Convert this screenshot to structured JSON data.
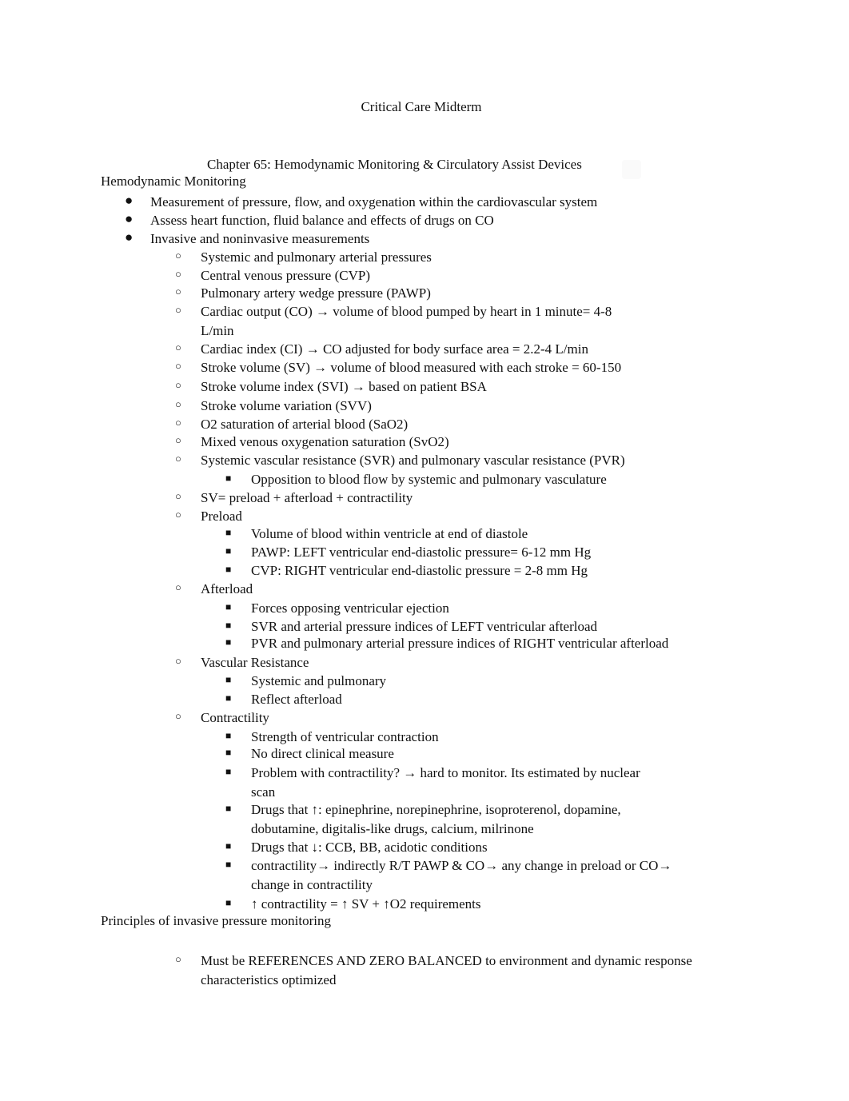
{
  "document": {
    "title": "Critical Care Midterm",
    "chapter": "Chapter 65: Hemodynamic Monitoring & Circulatory Assist Devices",
    "section1": "Hemodynamic Monitoring",
    "items": [
      {
        "level": 1,
        "bullet": "●",
        "text": "Measurement of pressure, flow, and oxygenation within the cardiovascular system"
      },
      {
        "level": 1,
        "bullet": "●",
        "text": "Assess heart function, fluid balance and effects of drugs on CO"
      },
      {
        "level": 1,
        "bullet": "●",
        "text": "Invasive and noninvasive measurements"
      },
      {
        "level": 2,
        "bullet": "○",
        "text": "Systemic and pulmonary arterial pressures"
      },
      {
        "level": 2,
        "bullet": "○",
        "text": "Central venous pressure (CVP)"
      },
      {
        "level": 2,
        "bullet": "○",
        "text": "Pulmonary artery wedge pressure (PAWP)"
      },
      {
        "level": 2,
        "bullet": "○",
        "text": "Cardiac output (CO) → volume of blood pumped by heart in 1 minute= 4-8",
        "cont": "L/min"
      },
      {
        "level": 2,
        "bullet": "○",
        "text": "Cardiac index (CI) → CO adjusted for body surface area = 2.2-4 L/min"
      },
      {
        "level": 2,
        "bullet": "○",
        "text": "Stroke volume (SV) → volume of blood measured with each stroke = 60-150"
      },
      {
        "level": 2,
        "bullet": "○",
        "text": "Stroke volume index (SVI) → based on patient BSA"
      },
      {
        "level": 2,
        "bullet": "○",
        "text": "Stroke volume variation (SVV)"
      },
      {
        "level": 2,
        "bullet": "○",
        "text": "O2 saturation of arterial blood (SaO2)"
      },
      {
        "level": 2,
        "bullet": "○",
        "text": "Mixed venous oxygenation saturation (SvO2)"
      },
      {
        "level": 2,
        "bullet": "○",
        "text": "Systemic vascular resistance (SVR) and pulmonary vascular resistance (PVR)"
      },
      {
        "level": 3,
        "bullet": "■",
        "text": "Opposition to blood flow by systemic and pulmonary vasculature"
      },
      {
        "level": 2,
        "bullet": "○",
        "text": "SV= preload + afterload + contractility"
      },
      {
        "level": 2,
        "bullet": "○",
        "text": "Preload"
      },
      {
        "level": 3,
        "bullet": "■",
        "text": "Volume of blood within ventricle at end of diastole"
      },
      {
        "level": 3,
        "bullet": "■",
        "text": "PAWP: LEFT ventricular end-diastolic pressure= 6-12 mm Hg"
      },
      {
        "level": 3,
        "bullet": "■",
        "text": "CVP: RIGHT ventricular end-diastolic pressure = 2-8 mm Hg"
      },
      {
        "level": 2,
        "bullet": "○",
        "text": "Afterload"
      },
      {
        "level": 3,
        "bullet": "■",
        "text": "Forces opposing ventricular ejection"
      },
      {
        "level": 3,
        "bullet": "■",
        "text": "SVR and arterial pressure indices of LEFT ventricular afterload"
      },
      {
        "level": 3,
        "bullet": "■",
        "text": "PVR and pulmonary arterial pressure indices of RIGHT ventricular afterload"
      },
      {
        "level": 2,
        "bullet": "○",
        "text": "Vascular Resistance"
      },
      {
        "level": 3,
        "bullet": "■",
        "text": "Systemic and pulmonary"
      },
      {
        "level": 3,
        "bullet": "■",
        "text": "Reflect afterload"
      },
      {
        "level": 2,
        "bullet": "○",
        "text": "Contractility"
      },
      {
        "level": 3,
        "bullet": "■",
        "text": "Strength of ventricular contraction"
      },
      {
        "level": 3,
        "bullet": "■",
        "text": "No direct clinical measure"
      },
      {
        "level": 3,
        "bullet": "■",
        "text": "Problem with contractility? → hard to monitor. Its estimated by nuclear",
        "cont": "scan"
      },
      {
        "level": 3,
        "bullet": "■",
        "text": "Drugs that ↑: epinephrine, norepinephrine, isoproterenol, dopamine,",
        "cont": "dobutamine, digitalis-like drugs, calcium, milrinone"
      },
      {
        "level": 3,
        "bullet": "■",
        "text": "Drugs that ↓: CCB, BB, acidotic conditions"
      },
      {
        "level": 3,
        "bullet": "■",
        "text": "contractility→ indirectly R/T PAWP & CO→ any change in preload or CO→",
        "cont": "change in contractility"
      },
      {
        "level": 3,
        "bullet": "■",
        "text": "↑ contractility = ↑ SV + ↑O2 requirements"
      }
    ],
    "section2": "Principles of invasive pressure monitoring",
    "items2": [
      {
        "level": 2,
        "bullet": "○",
        "text": "Must be REFERENCES AND ZERO BALANCED to environment and dynamic response",
        "cont": "characteristics optimized"
      }
    ]
  }
}
